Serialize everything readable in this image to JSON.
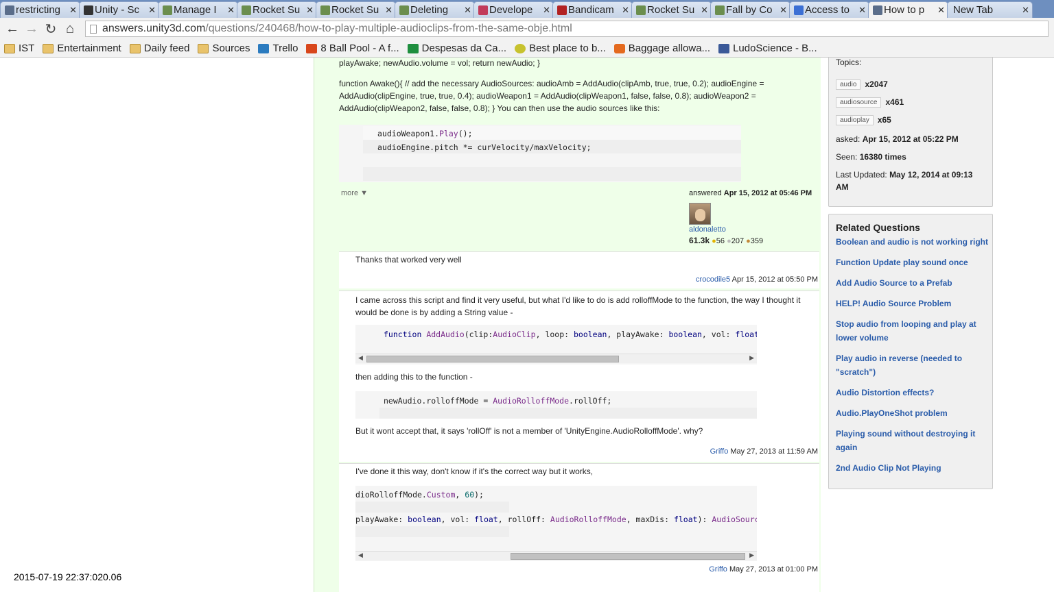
{
  "tabs": [
    {
      "title": "restricting",
      "color": "#5a6d8a"
    },
    {
      "title": "Unity - Sc",
      "color": "#333333"
    },
    {
      "title": "Manage I",
      "color": "#6b8e4e"
    },
    {
      "title": "Rocket Su",
      "color": "#6b8e4e"
    },
    {
      "title": "Rocket Su",
      "color": "#6b8e4e"
    },
    {
      "title": "Deleting",
      "color": "#6b8e4e"
    },
    {
      "title": "Develope",
      "color": "#c23b5a"
    },
    {
      "title": "Bandicam",
      "color": "#b22222"
    },
    {
      "title": "Rocket Su",
      "color": "#6b8e4e"
    },
    {
      "title": "Fall by Co",
      "color": "#6b8e4e"
    },
    {
      "title": "Access to",
      "color": "#3b6fd4"
    },
    {
      "title": "How to p",
      "color": "#5a6d8a"
    }
  ],
  "new_tab_label": "New Tab",
  "url": {
    "host": "answers.unity3d.com",
    "path": "/questions/240468/how-to-play-multiple-audioclips-from-the-same-obje.html"
  },
  "bookmarks": [
    {
      "label": "IST",
      "icon": "folder-icon"
    },
    {
      "label": "Entertainment",
      "icon": "folder-icon"
    },
    {
      "label": "Daily feed",
      "icon": "folder-icon"
    },
    {
      "label": "Sources",
      "icon": "folder-icon"
    },
    {
      "label": "Trello",
      "icon": "trello-icon"
    },
    {
      "label": "8 Ball Pool - A f...",
      "icon": "play-icon"
    },
    {
      "label": "Despesas da Ca...",
      "icon": "sheet-icon"
    },
    {
      "label": "Best place to b...",
      "icon": "smile-icon"
    },
    {
      "label": "Baggage allowa...",
      "icon": "e-icon"
    },
    {
      "label": "LudoScience - B...",
      "icon": "facebook-icon"
    }
  ],
  "answer": {
    "text_top": "playAwake; newAudio.volume = vol; return newAudio; }",
    "text_body": "function Awake(){ // add the necessary AudioSources: audioAmb = AddAudio(clipAmb, true, true, 0.2); audioEngine = AddAudio(clipEngine, true, true, 0.4); audioWeapon1 = AddAudio(clipWeapon1, false, false, 0.8); audioWeapon2 = AddAudio(clipWeapon2, false, false, 0.8); } You can then use the audio sources like this:",
    "code_line1": "audioWeapon1.Play();",
    "code_line2": "audioEngine.pitch *= curVelocity/maxVelocity;",
    "more": "more ▼",
    "answered_label": "answered",
    "answered_date": "Apr 15, 2012 at 05:46 PM",
    "author": "aldonaletto",
    "rep": "61.3k",
    "gold": "56",
    "silver": "207",
    "bronze": "359"
  },
  "comments": [
    {
      "text": "Thanks that worked very well",
      "author": "crocodile5",
      "date": "Apr 15, 2012 at 05:50 PM"
    },
    {
      "text": "I came across this script and find it very useful, but what I'd like to do is add rolloffMode to the function, the way I thought it would be done is by adding a String value -",
      "code1": "function AddAudio(clip:AudioClip, loop: boolean, playAwake: boolean, vol: float, ro",
      "text2": "then adding this to the function -",
      "code2": "newAudio.rolloffMode = AudioRolloffMode.rollOff;",
      "text3": "But it wont accept that, it says 'rollOff' is not a member of 'UnityEngine.AudioRolloffMode'. why?",
      "author": "Griffo",
      "date": "May 27, 2013 at 11:59 AM"
    },
    {
      "text": "I've done it this way, don't know if it's the correct way but it works,",
      "code1": "dioRolloffMode.Custom, 60);",
      "code2": " playAwake: boolean, vol: float, rollOff: AudioRolloffMode, maxDis: float): AudioSource {",
      "author": "Griffo",
      "date": "May 27, 2013 at 01:00 PM"
    }
  ],
  "sidebar": {
    "topics_label": "Topics:",
    "tags": [
      {
        "name": "audio",
        "count": "x2047"
      },
      {
        "name": "audiosource",
        "count": "x461"
      },
      {
        "name": "audioplay",
        "count": "x65"
      }
    ],
    "asked_label": "asked:",
    "asked_value": "Apr 15, 2012 at 05:22 PM",
    "seen_label": "Seen:",
    "seen_value": "16380 times",
    "updated_label": "Last Updated:",
    "updated_value": "May 12, 2014 at 09:13 AM",
    "related_title": "Related Questions",
    "related": [
      "Boolean and audio is not working right",
      "Function Update play sound once",
      "Add Audio Source to a Prefab",
      "HELP! Audio Source Problem",
      "Stop audio from looping and play at lower volume",
      "Play audio in reverse (needed to \"scratch\")",
      "Audio Distortion effects?",
      "Audio.PlayOneShot problem",
      "Playing sound without destroying it again",
      "2nd Audio Clip Not Playing"
    ]
  },
  "timestamp": "2015-07-19 22:37:020.06"
}
